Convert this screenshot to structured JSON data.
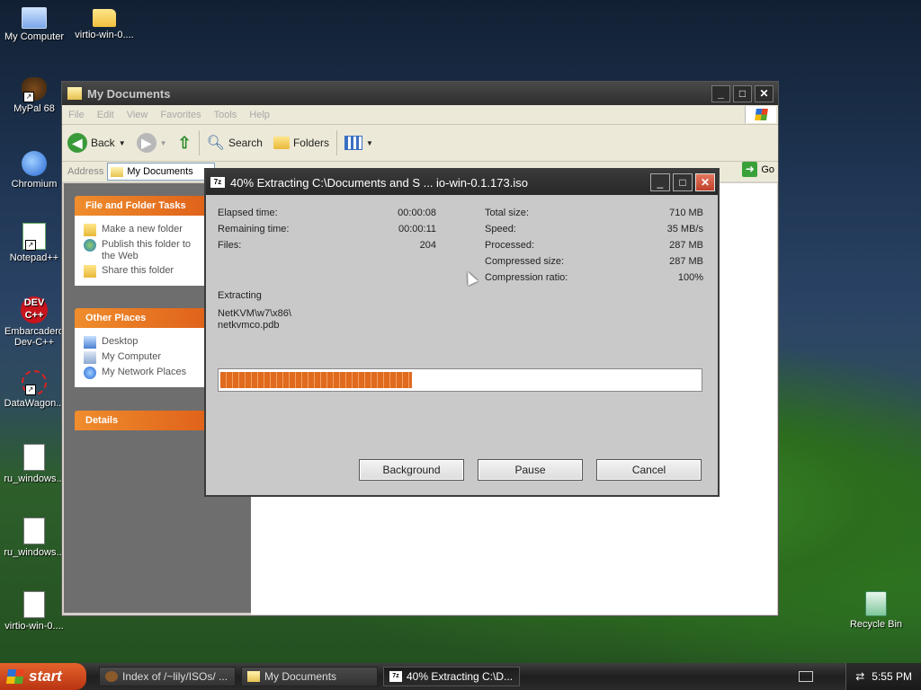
{
  "desktop": {
    "icons": [
      {
        "label": "My Computer",
        "icon": "my-computer-icon"
      },
      {
        "label": "virtio-win-0....",
        "icon": "folder-icon"
      },
      {
        "label": "MyPal 68",
        "icon": "mypal-icon"
      },
      {
        "label": "Chromium",
        "icon": "chromium-icon"
      },
      {
        "label": "Notepad++",
        "icon": "notepad-plus-plus-icon"
      },
      {
        "label": "Embarcadero Dev-C++",
        "icon": "dev-cpp-icon"
      },
      {
        "label": "DataWagon...",
        "icon": "datawagon-icon"
      },
      {
        "label": "ru_windows...",
        "icon": "document-icon"
      },
      {
        "label": "ru_windows...",
        "icon": "document-icon"
      },
      {
        "label": "virtio-win-0....",
        "icon": "document-icon"
      },
      {
        "label": "Recycle Bin",
        "icon": "recycle-bin-icon"
      }
    ],
    "dev_icon_text": "DEV\nC++"
  },
  "explorer": {
    "title": "My Documents",
    "menu": [
      "File",
      "Edit",
      "View",
      "Favorites",
      "Tools",
      "Help"
    ],
    "toolbar": {
      "back": "Back",
      "search": "Search",
      "folders": "Folders"
    },
    "address_label": "Address",
    "address_value": "My Documents",
    "go_label": "Go",
    "file_tasks": {
      "header": "File and Folder Tasks",
      "items": [
        "Make a new folder",
        "Publish this folder to the Web",
        "Share this folder"
      ]
    },
    "other_places": {
      "header": "Other Places",
      "items": [
        "Desktop",
        "My Computer",
        "My Network Places"
      ]
    },
    "details_header": "Details"
  },
  "extract_dialog": {
    "title": "40% Extracting C:\\Documents and S ... io-win-0.1.173.iso",
    "progress_percent": 40,
    "left_stats": [
      {
        "label": "Elapsed time:",
        "value": "00:00:08"
      },
      {
        "label": "Remaining time:",
        "value": "00:00:11"
      },
      {
        "label": "Files:",
        "value": "204"
      }
    ],
    "right_stats": [
      {
        "label": "Total size:",
        "value": "710 MB"
      },
      {
        "label": "Speed:",
        "value": "35 MB/s"
      },
      {
        "label": "Processed:",
        "value": "287 MB"
      },
      {
        "label": "Compressed size:",
        "value": "287 MB"
      },
      {
        "label": "Compression ratio:",
        "value": "100%"
      }
    ],
    "operation_label": "Extracting",
    "current_path": "NetKVM\\w7\\x86\\",
    "current_file": "netkvmco.pdb",
    "buttons": {
      "background": "Background",
      "pause": "Pause",
      "cancel": "Cancel"
    }
  },
  "taskbar": {
    "start_label": "start",
    "tasks": [
      {
        "label": "Index of /~lily/ISOs/ ...",
        "active": false
      },
      {
        "label": "My Documents",
        "active": false
      },
      {
        "label": "40% Extracting C:\\D...",
        "active": true
      }
    ],
    "clock": "5:55 PM"
  },
  "colors": {
    "panel_header": "#e0621a",
    "progress_fill": "#e06a1e",
    "start_button": "#c9441a"
  }
}
